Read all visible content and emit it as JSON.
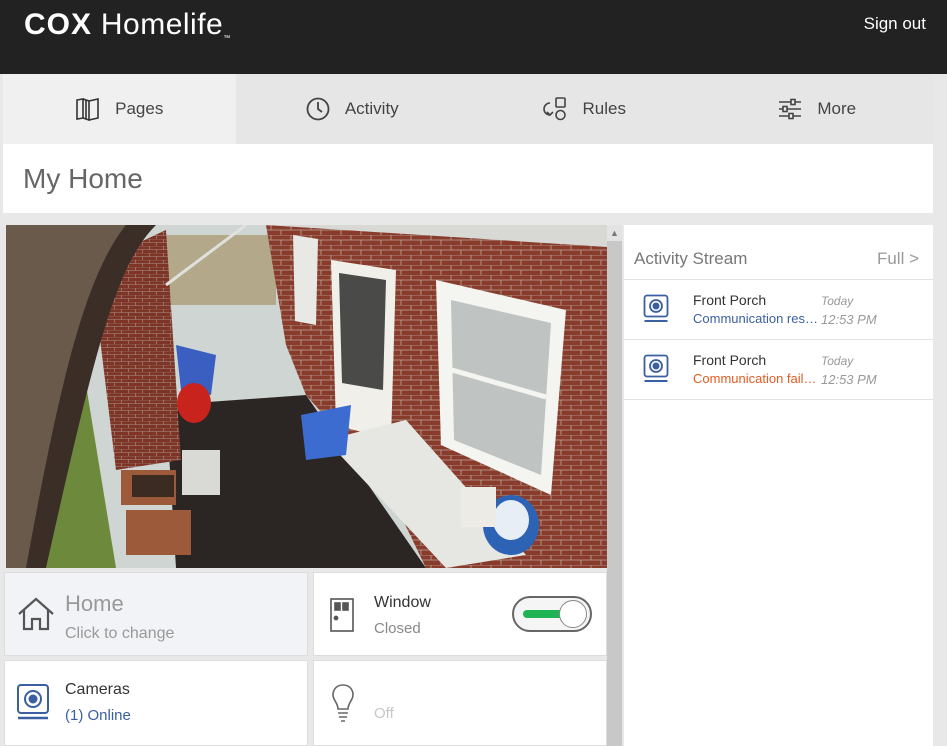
{
  "header": {
    "logo_brand": "COX",
    "logo_product": "Homelife",
    "logo_tm": "™",
    "sign_out": "Sign out"
  },
  "nav": {
    "tabs": [
      {
        "label": "Pages",
        "icon": "pages-icon",
        "active": true
      },
      {
        "label": "Activity",
        "icon": "clock-icon",
        "active": false
      },
      {
        "label": "Rules",
        "icon": "rules-icon",
        "active": false
      },
      {
        "label": "More",
        "icon": "sliders-icon",
        "active": false
      }
    ]
  },
  "page": {
    "title": "My Home"
  },
  "camera": {
    "feed_icon": "live-camera-feed"
  },
  "tiles": {
    "home": {
      "title": "Home",
      "subtitle": "Click to change",
      "icon": "house-icon"
    },
    "window": {
      "title": "Window",
      "subtitle": "Closed",
      "icon": "window-sensor-icon",
      "toggle_on": true
    },
    "cameras": {
      "title": "Cameras",
      "subtitle": "(1) Online",
      "icon": "camera-icon"
    },
    "light": {
      "title": "",
      "subtitle": "Off",
      "icon": "lightbulb-icon"
    }
  },
  "activity_stream": {
    "title": "Activity Stream",
    "full_link": "Full >",
    "events": [
      {
        "name": "Front Porch",
        "message": "Communication restored",
        "day": "Today",
        "time": "12:53 PM",
        "status": "ok"
      },
      {
        "name": "Front Porch",
        "message": "Communication failure",
        "day": "Today",
        "time": "12:53 PM",
        "status": "fail"
      }
    ]
  },
  "colors": {
    "topbar": "#222222",
    "toggle_on": "#1fb453",
    "link_blue": "#3b5fa3",
    "alert_orange": "#e55a1f"
  }
}
